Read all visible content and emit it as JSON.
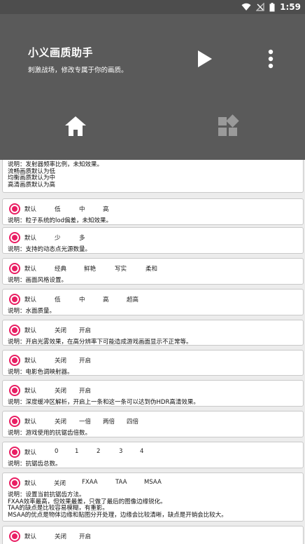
{
  "status_bar": {
    "time": "1:59",
    "icons": [
      "wifi-icon",
      "no-signal-icon",
      "battery-icon"
    ]
  },
  "header": {
    "title": "小义画质助手",
    "subtitle": "刺激战场，修改专属于你的画质。",
    "actions": [
      "play-icon",
      "more-vert-icon"
    ],
    "nav": [
      "home-icon",
      "widgets-icon"
    ]
  },
  "colors": {
    "status_bar": "#4d4d4d",
    "header": "#5a5a5a",
    "accent": "#e91e63",
    "background": "#ececec"
  },
  "settings": [
    {
      "options": [],
      "desc": [
        "说明：发射器频率比例，未知效果。",
        "流畅画质默认为低",
        "均衡画质默认为中",
        "高清画质默认为高"
      ]
    },
    {
      "options": [
        "默认",
        "低",
        "中",
        "高"
      ],
      "selected": 0,
      "desc": [
        "说明：粒子系统的lod偏差，未知效果。"
      ]
    },
    {
      "options": [
        "默认",
        "少",
        "多"
      ],
      "selected": 0,
      "desc": [
        "说明：支持的动态点光源数量。"
      ]
    },
    {
      "options": [
        "默认",
        "经典",
        "鲜艳",
        "写实",
        "柔和"
      ],
      "selected": 0,
      "desc": [
        "说明：画面风格设置。"
      ]
    },
    {
      "options": [
        "默认",
        "低",
        "中",
        "高",
        "超高"
      ],
      "selected": 0,
      "desc": [
        "说明：水面质量。"
      ]
    },
    {
      "options": [
        "默认",
        "关闭",
        "开启"
      ],
      "selected": 0,
      "desc": [
        "说明：开启光雾效果，在高分辨率下可能造成游戏画面显示不正常等。"
      ]
    },
    {
      "options": [
        "默认",
        "关闭",
        "开启"
      ],
      "selected": 0,
      "desc": [
        "说明：电影色调映射器。"
      ]
    },
    {
      "options": [
        "默认",
        "关闭",
        "开启"
      ],
      "selected": 0,
      "desc": [
        "说明：深度缓冲区解析，开启上一条和这一条可以达到伪HDR高清效果。"
      ]
    },
    {
      "options": [
        "默认",
        "关闭",
        "一倍",
        "两倍",
        "四倍"
      ],
      "selected": 0,
      "desc": [
        "说明：游戏使用的抗锯齿倍数。"
      ]
    },
    {
      "options": [
        "默认",
        "0",
        "1",
        "2",
        "3",
        "4"
      ],
      "selected": 0,
      "desc": [
        "说明：抗锯齿总数。"
      ]
    },
    {
      "options": [
        "默认",
        "关闭",
        "FXAA",
        "TAA",
        "MSAA"
      ],
      "selected": 0,
      "desc": [
        "说明：设置当前抗锯齿方法。",
        "FXAA效率最高，但效果最差，只做了最后的图像边缘锐化。",
        "TAA的缺点是比较容易模糊，有重影。",
        "MSAA的优点是物体边缘和贴图分开处理，边缘会比较清晰，缺点是开销会比较大。"
      ]
    },
    {
      "options": [
        "默认",
        "关闭",
        "开启"
      ],
      "selected": 0,
      "desc": []
    }
  ]
}
